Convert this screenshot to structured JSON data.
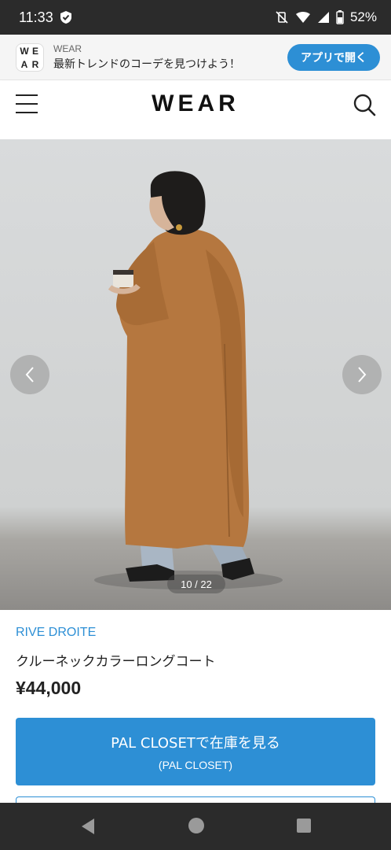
{
  "status_bar": {
    "time": "11:33",
    "battery": "52%"
  },
  "app_banner": {
    "logo_letters": [
      "W",
      "E",
      "A",
      "R"
    ],
    "app_name": "WEAR",
    "tagline": "最新トレンドのコーデを見つけよう！",
    "open_button": "アプリで開く"
  },
  "header": {
    "logo": "WEAR"
  },
  "carousel": {
    "counter": "10 / 22"
  },
  "product": {
    "brand": "RIVE DROITE",
    "name": "クルーネックカラーロングコート",
    "price": "¥44,000"
  },
  "stock_button": {
    "label": "PAL CLOSETで在庫を見る",
    "sub": "(PAL CLOSET)"
  },
  "colors": {
    "accent": "#2d8fd5",
    "coat": "#b5773f",
    "status_bar": "#2b2b2b"
  }
}
